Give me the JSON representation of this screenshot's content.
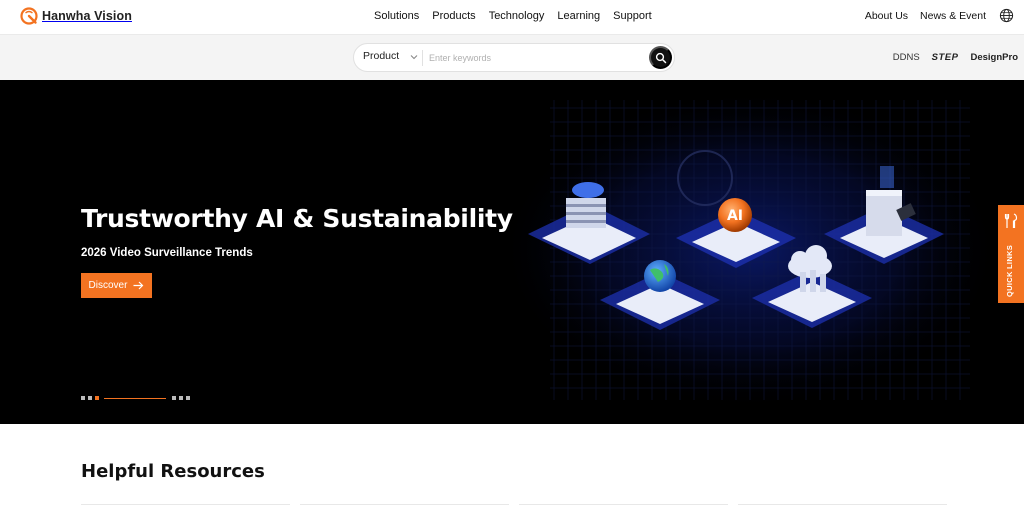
{
  "brand": {
    "name": "Hanwha Vision",
    "accent": "#f37321"
  },
  "nav": {
    "main": [
      "Solutions",
      "Products",
      "Technology",
      "Learning",
      "Support"
    ],
    "utility": [
      "About Us",
      "News & Event"
    ],
    "language_icon": "globe-icon"
  },
  "search": {
    "category": "Product",
    "placeholder": "Enter keywords",
    "value": "",
    "button_icon": "search-icon"
  },
  "quick_tools": {
    "ddns": "DDNS",
    "step": "STEP",
    "designpro": "DesignPro"
  },
  "hero": {
    "title": "Trustworthy AI & Sustainability",
    "subtitle": "2026 Video Surveillance Trends",
    "cta_label": "Discover",
    "badge_text": "AI",
    "slide_count": 6,
    "active_slide": 3
  },
  "quick_links": {
    "label": "QUICK LINKS"
  },
  "resources": {
    "title": "Helpful Resources"
  }
}
